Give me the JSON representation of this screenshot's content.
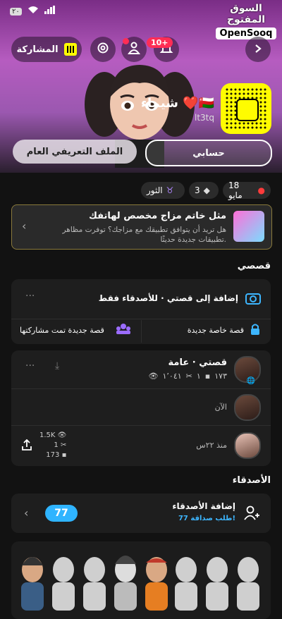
{
  "status": {
    "badge": "٢٠",
    "logo_ar": "السوق المفتوح",
    "logo_en": "OpenSooq"
  },
  "header": {
    "share_label": "المشاركة",
    "notification_count": "10+",
    "display_name": "شيماء ❤️🇴🇲",
    "username": "lt3tq",
    "tab_my_account": "حسابي",
    "tab_public_profile": "الملف التعريفي العام"
  },
  "chips": {
    "birthday": "18 مايو",
    "friends_count": "3",
    "zodiac": "الثور"
  },
  "promo": {
    "title": "مثل خاتم مزاج مخصص لهاتفك",
    "body": "هل تريد أن يتوافق تطبيقك مع مزاجك؟ توفرت مظاهر تطبيقات جديدة حديثًا."
  },
  "stories_section": {
    "title": "قصصي",
    "add_story": "إضافة إلى قصتي · للأصدقاء فقط",
    "new_private": "قصة خاصة جديدة",
    "new_shared": "قصة جديدة تمت مشاركتها"
  },
  "my_story": {
    "title": "قصتي · عامة",
    "views": "١٬٠٤١",
    "screenshots": "١",
    "replies": "١٧٣",
    "item1_time": "الآن",
    "item2_time": "منذ ٢٢س",
    "item2_views": "1.5K",
    "item2_screens": "1",
    "item2_replies": "173"
  },
  "friends_section": {
    "title": "الأصدقاء",
    "add_friends": "إضافة الأصدقاء",
    "requests": "77 طلب صداقة!",
    "count": "77"
  },
  "colors": {
    "accent_blue": "#2fb4ff",
    "snap_yellow": "#fffc00",
    "alert_red": "#ff2d55"
  }
}
